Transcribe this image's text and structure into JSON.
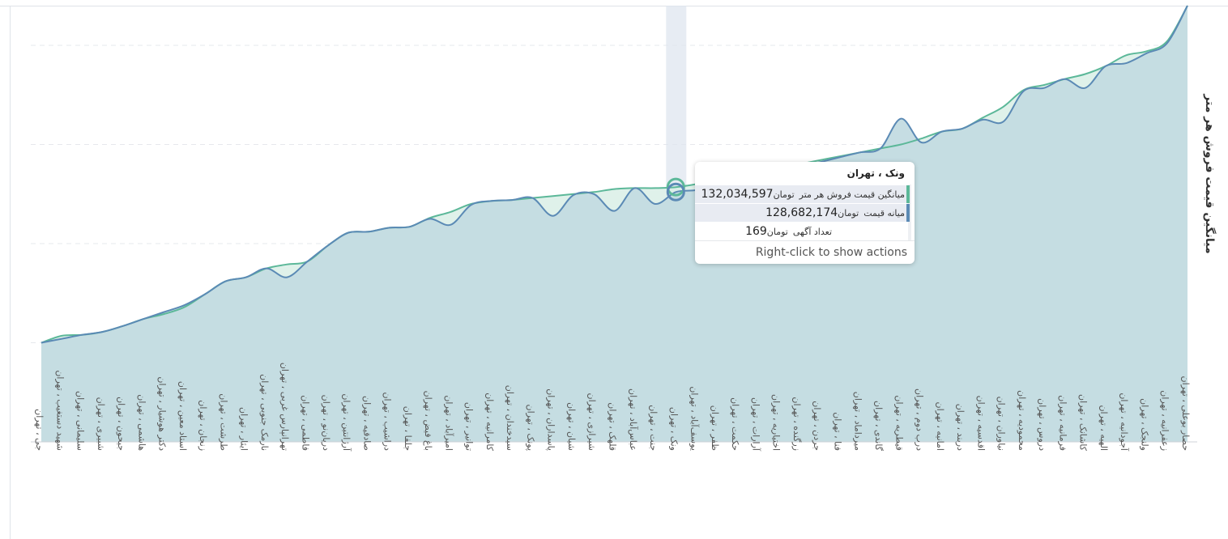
{
  "chart_data": {
    "type": "area",
    "ylabel": "میانگین قیمت فروش هر متر",
    "categories": [
      "جی ، تهران",
      "شهید دستغیب ، تهران",
      "سلیمانی ، تهران",
      "شبیری ، تهران",
      "جیحون ، تهران",
      "هاشمی ، تهران",
      "دکتر هوشیار ، تهران",
      "استاد معین ، تهران",
      "زنجان ، تهران",
      "طرشت ، تهران",
      "ایثار ، تهران",
      "نارمک جنوبی ، تهران",
      "تهرانپارس غربی ، تهران",
      "فاطمی ، تهران",
      "دریان‌نو ، تهران",
      "آرژانتین ، تهران",
      "صادقیه ، تهران",
      "دراشیب ، تهران",
      "جلفا ، تهران",
      "باغ فیض ، تهران",
      "امیرآباد ، تهران",
      "توانیر ، تهران",
      "کامرانیه ، تهران",
      "سیدخندان ، تهران",
      "پونک ، تهران",
      "پاسداران ، تهران",
      "شیان ، تهران",
      "شیرازی ، تهران",
      "قلهک ، تهران",
      "عباس‌آباد ، تهران",
      "جنت ، تهران",
      "ونک ، تهران",
      "یوسف‌آباد ، تهران",
      "ظفر ، تهران",
      "حکمت ، تهران",
      "آرارات ، تهران",
      "اختیاریه ، تهران",
      "زرگنده ، تهران",
      "جردن ، تهران",
      "فنا ، تهران",
      "میرداماد ، تهران",
      "گاندی ، تهران",
      "قیطریه ، تهران",
      "درب دوم ، تهران",
      "امانیه ، تهران",
      "دربند ، تهران",
      "اقدسیه ، تهران",
      "نیاوران ، تهران",
      "محمودیه ، تهران",
      "دروس ، تهران",
      "فرمانیه ، تهران",
      "کاشانک ، تهران",
      "الهیه ، تهران",
      "آجودانیه ، تهران",
      "ولنجک ، تهران",
      "زعفرانیه ، تهران",
      "حصار بوعلی ، تهران"
    ],
    "series": [
      {
        "name": "میانگین قیمت فروش هر متر",
        "color": "#5cb899",
        "values": [
          100.0,
          103.5,
          104.0,
          105.5,
          108.5,
          112.0,
          114.5,
          118.0,
          124.5,
          131.0,
          133.0,
          137.5,
          139.5,
          141.0,
          149.0,
          155.5,
          156.0,
          158.0,
          158.5,
          163.0,
          166.0,
          170.0,
          171.5,
          172.0,
          173.0,
          174.0,
          175.0,
          176.0,
          177.5,
          178.0,
          178.0,
          178.5,
          180.0,
          182.0,
          184.0,
          186.0,
          188.0,
          190.0,
          192.0,
          194.0,
          196.0,
          198.0,
          200.0,
          203.0,
          206.5,
          208.0,
          213.5,
          219.0,
          227.5,
          230.0,
          233.0,
          235.5,
          239.5,
          245.0,
          247.0,
          252.0,
          270.0
        ]
      },
      {
        "name": "میانه قیمت",
        "color": "#5b8ab5",
        "values": [
          100.0,
          102.0,
          104.0,
          105.5,
          108.5,
          112.0,
          115.5,
          119.0,
          124.5,
          131.0,
          133.0,
          137.5,
          133.0,
          141.0,
          149.0,
          155.5,
          156.0,
          158.0,
          158.5,
          162.5,
          159.5,
          169.5,
          171.5,
          172.0,
          173.0,
          164.0,
          174.5,
          175.0,
          166.5,
          178.0,
          170.0,
          176.0,
          177.0,
          180.0,
          182.0,
          184.0,
          186.5,
          188.5,
          191.0,
          193.5,
          196.0,
          198.0,
          213.0,
          201.0,
          206.5,
          208.0,
          212.5,
          211.5,
          227.0,
          228.5,
          233.0,
          228.5,
          239.5,
          241.0,
          246.0,
          251.0,
          270.0
        ]
      }
    ],
    "ylim": [
      50,
      270
    ],
    "grid": true,
    "legend": "none",
    "highlight_category": "ونک ، تهران",
    "fill_color": "#c3dbe2"
  },
  "tooltip": {
    "title": "ونک ، تهران",
    "rows": [
      {
        "label": "میانگین قیمت فروش هر متر",
        "unit": "تومان",
        "value": "132,034,597",
        "color": "#5cb899"
      },
      {
        "label": "میانه قیمت",
        "unit": "تومان",
        "value": "128,682,174",
        "color": "#5b8ab5"
      },
      {
        "label": "تعداد آگهی",
        "unit": "تومان",
        "value": "169"
      }
    ],
    "footer": "Right-click to show actions"
  }
}
